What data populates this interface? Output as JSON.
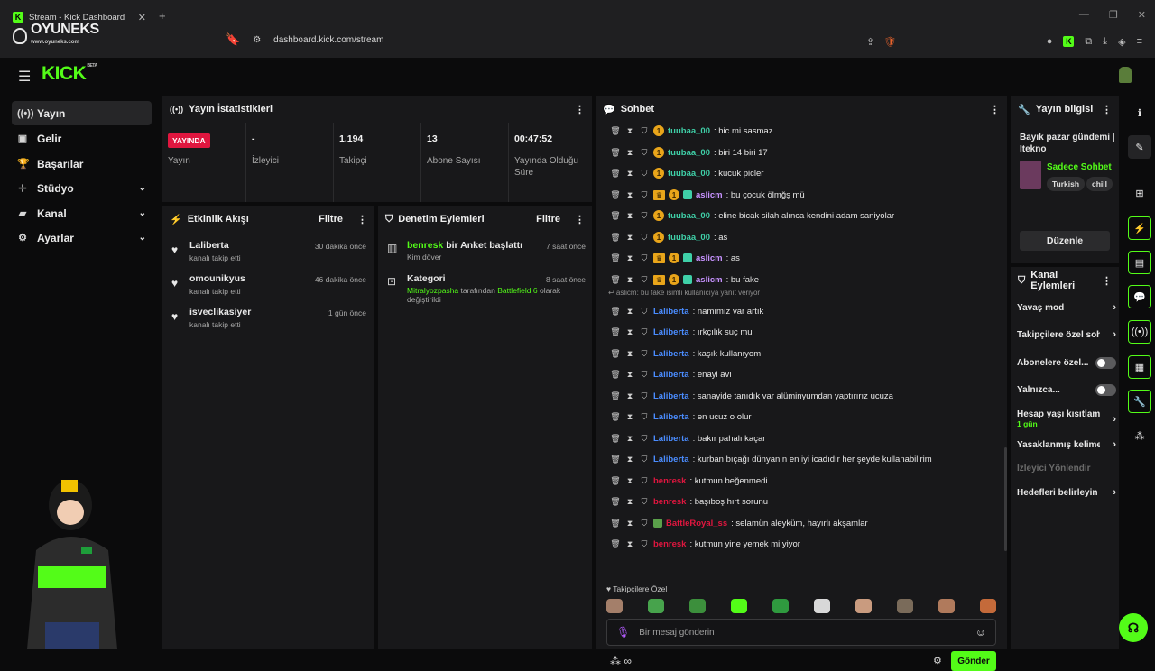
{
  "browser": {
    "tab_title": "Stream - Kick Dashboard",
    "url": "dashboard.kick.com/stream",
    "watermark": "OYUNEKS",
    "watermark_sub": "www.oyuneks.com"
  },
  "brand": {
    "logo": "KICK",
    "beta": "BETA",
    "accent": "#53fc18"
  },
  "sidebar": {
    "items": [
      {
        "label": "Yayın",
        "icon": "broadcast-icon"
      },
      {
        "label": "Gelir",
        "icon": "revenue-icon"
      },
      {
        "label": "Başarılar",
        "icon": "trophy-icon"
      },
      {
        "label": "Stüdyo",
        "icon": "studio-icon"
      },
      {
        "label": "Kanal",
        "icon": "channel-icon"
      },
      {
        "label": "Ayarlar",
        "icon": "gear-icon"
      }
    ]
  },
  "stats": {
    "title": "Yayın İstatistikleri",
    "live_badge": "YAYINDA",
    "items": [
      {
        "value": "",
        "label": "Yayın"
      },
      {
        "value": "-",
        "label": "İzleyici"
      },
      {
        "value": "1.194",
        "label": "Takipçi"
      },
      {
        "value": "13",
        "label": "Abone Sayısı"
      },
      {
        "value": "00:47:52",
        "label": "Yayında Olduğu Süre"
      }
    ]
  },
  "activity": {
    "title": "Etkinlik Akışı",
    "filter": "Filtre",
    "items": [
      {
        "name": "Laliberta",
        "sub": "kanalı takip etti",
        "time": "30 dakika önce"
      },
      {
        "name": "omounikyus",
        "sub": "kanalı takip etti",
        "time": "46 dakika önce"
      },
      {
        "name": "isveclikasiyer",
        "sub": "kanalı takip etti",
        "time": "1 gün önce"
      }
    ]
  },
  "moderation": {
    "title": "Denetim Eylemleri",
    "filter": "Filtre",
    "items": [
      {
        "name_user": "benresk",
        "name_rest": " bir Anket başlattı",
        "sub": "Kim döver",
        "time": "7 saat önce"
      },
      {
        "name_rest": "Kategori",
        "sub_user": "Mitralyozpasha",
        "sub_mid": " tarafından ",
        "sub_cat": "Battlefield 6",
        "sub_end": " olarak değiştirildi",
        "time": "8 saat önce"
      }
    ]
  },
  "chat": {
    "title": "Sohbet",
    "messages": [
      {
        "user": "tuubaa_00",
        "color": "#3fd0a8",
        "text": ": hic mi sasmaz",
        "badges": [
          "sub"
        ]
      },
      {
        "user": "tuubaa_00",
        "color": "#3fd0a8",
        "text": ": biri 14 biri 17",
        "badges": [
          "sub"
        ]
      },
      {
        "user": "tuubaa_00",
        "color": "#3fd0a8",
        "text": ": kucuk picler",
        "badges": [
          "sub"
        ]
      },
      {
        "user": "aslicm",
        "color": "#c792ff",
        "text": ": bu çocuk ölmğş mü",
        "badges": [
          "crown",
          "sub",
          "bot"
        ]
      },
      {
        "user": "tuubaa_00",
        "color": "#3fd0a8",
        "text": ": eline bicak silah alınca kendini adam saniyolar",
        "badges": [
          "sub"
        ]
      },
      {
        "user": "tuubaa_00",
        "color": "#3fd0a8",
        "text": ": as",
        "badges": [
          "sub"
        ]
      },
      {
        "user": "aslicm",
        "color": "#c792ff",
        "text": ": as",
        "badges": [
          "crown",
          "sub",
          "bot"
        ]
      },
      {
        "user": "aslicm",
        "color": "#c792ff",
        "text": ": bu fake",
        "badges": [
          "crown",
          "sub",
          "bot"
        ]
      },
      {
        "user": "Laliberta",
        "color": "#4a8cff",
        "text": ": namımız var artık",
        "badges": []
      },
      {
        "user": "Laliberta",
        "color": "#4a8cff",
        "text": ": ırkçılık suç mu",
        "badges": []
      },
      {
        "user": "Laliberta",
        "color": "#4a8cff",
        "text": ": kaşık kullanıyom",
        "badges": []
      },
      {
        "user": "Laliberta",
        "color": "#4a8cff",
        "text": ": enayi avı",
        "badges": []
      },
      {
        "user": "Laliberta",
        "color": "#4a8cff",
        "text": ": sanayide tanıdık var alüminyumdan yaptırırız ucuza",
        "badges": []
      },
      {
        "user": "Laliberta",
        "color": "#4a8cff",
        "text": ": en ucuz o olur",
        "badges": []
      },
      {
        "user": "Laliberta",
        "color": "#4a8cff",
        "text": ": bakır pahalı kaçar",
        "badges": []
      },
      {
        "user": "Laliberta",
        "color": "#4a8cff",
        "text": ": kurban bıçağı dünyanın en iyi icadıdır her şeyde kullanabilirim",
        "badges": []
      },
      {
        "user": "benresk",
        "color": "#e0163f",
        "text": ": kutmun beğenmedi",
        "badges": []
      },
      {
        "user": "benresk",
        "color": "#e0163f",
        "text": ": başıboş hırt sorunu",
        "badges": []
      },
      {
        "user": "BattleRoyal_ss",
        "color": "#e0163f",
        "text": ": selamün aleyküm, hayırlı akşamlar",
        "badges": [
          "pepe"
        ]
      },
      {
        "user": "benresk",
        "color": "#e0163f",
        "text": ": kutmun yine yemek mi yiyor",
        "badges": []
      }
    ],
    "reply_note": "↩ aslicm: bu fake isimli kullanıcıya yanıt veriyor",
    "followers_only": "♥ Takipçilere Özel",
    "input_placeholder": "Bir mesaj gönderin",
    "send_label": "Gönder",
    "bottom_symbol": "∞"
  },
  "stream_info": {
    "title": "Yayın bilgisi",
    "stream_title": "Bayık pazar gündemi | Itekno",
    "category": "Sadece Sohbet",
    "tags": [
      "Turkish",
      "chill"
    ],
    "edit_label": "Düzenle"
  },
  "channel_actions": {
    "title": "Kanal Eylemleri",
    "items": [
      {
        "label": "Yavaş mod",
        "kind": "chevron"
      },
      {
        "label": "Takipçilere özel sohbet",
        "kind": "chevron"
      },
      {
        "label": "Abonelere özel...",
        "kind": "toggle"
      },
      {
        "label": "Yalnızca...",
        "kind": "toggle"
      },
      {
        "label": "Hesap yaşı kısıtlaması",
        "sub": "1 gün",
        "kind": "chevron"
      },
      {
        "label": "Yasaklanmış kelimeler",
        "kind": "chevron"
      },
      {
        "label": "İzleyici Yönlendir",
        "kind": "disabled"
      },
      {
        "label": "Hedefleri belirleyin",
        "kind": "chevron"
      }
    ]
  }
}
